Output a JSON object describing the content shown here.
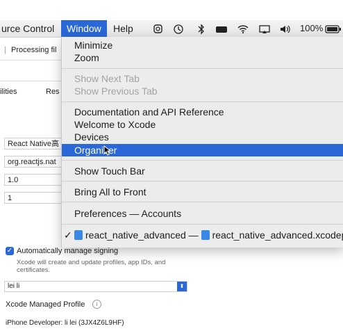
{
  "menubar": {
    "source_control": "urce Control",
    "window": "Window",
    "help": "Help",
    "battery": "100%"
  },
  "background": {
    "breadcrumb_sep": "|",
    "processing": "Processing fil",
    "tab_capabilities": "ilities",
    "tab_resources": "Res",
    "display_name": "React Native高",
    "bundle_id": "org.reactjs.nat",
    "version": "1.0",
    "build": "1",
    "auto_signing_label": "Automatically manage signing",
    "auto_signing_desc": "Xcode will create and update profiles, app IDs, and certificates.",
    "team": "lei li",
    "profile": "Xcode Managed Profile",
    "certificate": "iPhone Developer: li lei (3JX4Z6L9HF)"
  },
  "menu": {
    "minimize": "Minimize",
    "zoom": "Zoom",
    "show_next_tab": "Show Next Tab",
    "show_prev_tab": "Show Previous Tab",
    "documentation": "Documentation and API Reference",
    "welcome": "Welcome to Xcode",
    "devices": "Devices",
    "organizer": "Organizer",
    "touch_bar": "Show Touch Bar",
    "bring_all": "Bring All to Front",
    "preferences": "Preferences — Accounts",
    "window_item_checkmark": "✓",
    "window_item_project": "react_native_advanced",
    "window_item_dash": "—",
    "window_item_file": "react_native_advanced.xcodep"
  },
  "colors": {
    "highlight": "#2a67d7",
    "menu_bg": "#ececec"
  }
}
